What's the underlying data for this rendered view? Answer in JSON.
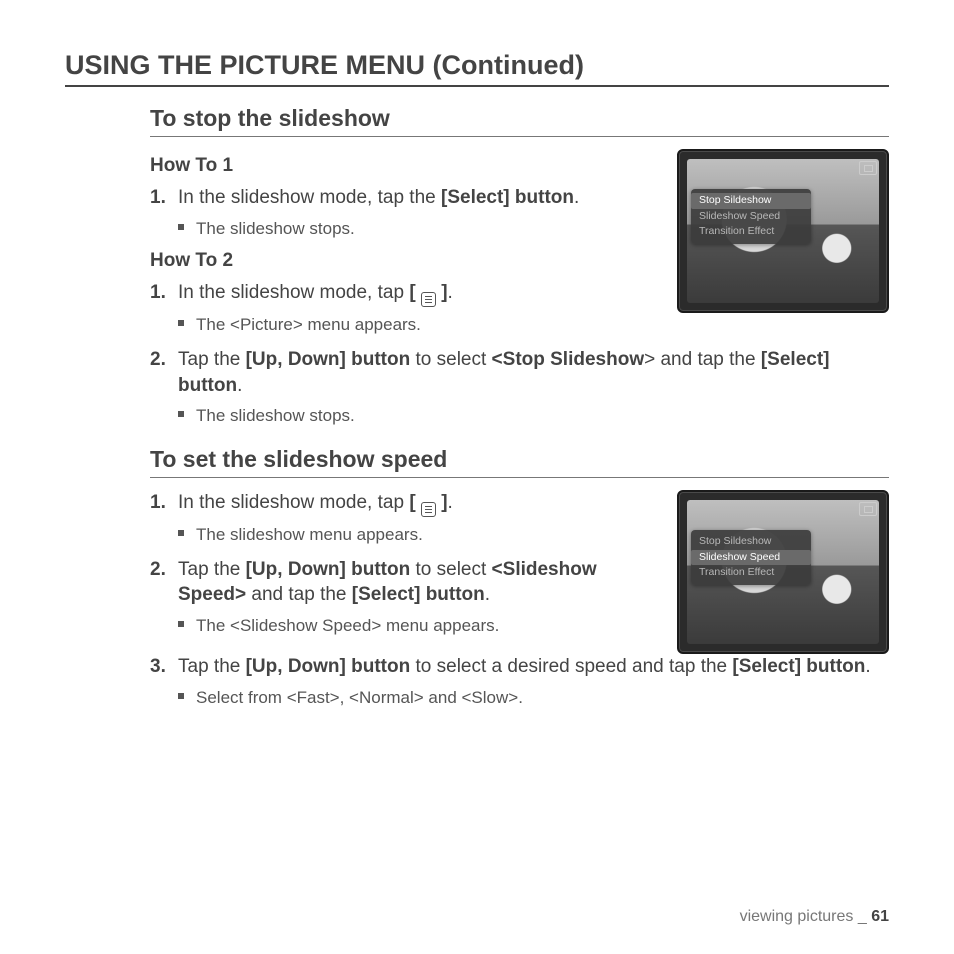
{
  "title": "USING THE PICTURE MENU (Continued)",
  "section1": {
    "heading": "To stop the slideshow",
    "howto1_label": "How To 1",
    "step1_1_pre": "In the slideshow mode, tap the ",
    "step1_1_bold": "[Select] button",
    "step1_1_post": ".",
    "bullet1_1": "The slideshow stops.",
    "howto2_label": "How To 2",
    "step2_1_pre": "In the slideshow mode, tap ",
    "step2_1_b1": "[ ",
    "step2_1_b2": " ]",
    "step2_1_post": ".",
    "bullet2_1": "The <Picture> menu appears.",
    "step2_2_pre": "Tap the ",
    "step2_2_b1": "[Up, Down] button",
    "step2_2_mid": " to select ",
    "step2_2_b2": "<Stop Slideshow",
    "step2_2_mid2": "> and tap the ",
    "step2_2_b3": "[Select] button",
    "step2_2_post": ".",
    "bullet2_2": "The slideshow stops."
  },
  "figure1": {
    "menu_item1": "Stop Sildeshow",
    "menu_item2": "Slideshow Speed",
    "menu_item3": "Transition Effect",
    "selected": 0
  },
  "section2": {
    "heading": "To set the slideshow speed",
    "step1_pre": "In the slideshow mode, tap ",
    "step1_b1": "[ ",
    "step1_b2": " ]",
    "step1_post": ".",
    "bullet1": "The slideshow menu appears.",
    "step2_pre": "Tap the ",
    "step2_b1": "[Up, Down] button",
    "step2_mid": " to select ",
    "step2_b2": "<Slideshow Speed>",
    "step2_mid2": " and tap the ",
    "step2_b3": "[Select] button",
    "step2_post": ".",
    "bullet2": "The <Slideshow Speed> menu appears.",
    "step3_pre": "Tap the ",
    "step3_b1": "[Up, Down] button",
    "step3_mid": " to select a desired speed and tap the ",
    "step3_b2": "[Select] button",
    "step3_post": ".",
    "bullet3": "Select from <Fast>, <Normal> and <Slow>."
  },
  "figure2": {
    "menu_item1": "Stop Sildeshow",
    "menu_item2": "Slideshow Speed",
    "menu_item3": "Transition Effect",
    "selected": 1
  },
  "footer": {
    "section": "viewing pictures",
    "sep": " _ ",
    "page": "61"
  }
}
